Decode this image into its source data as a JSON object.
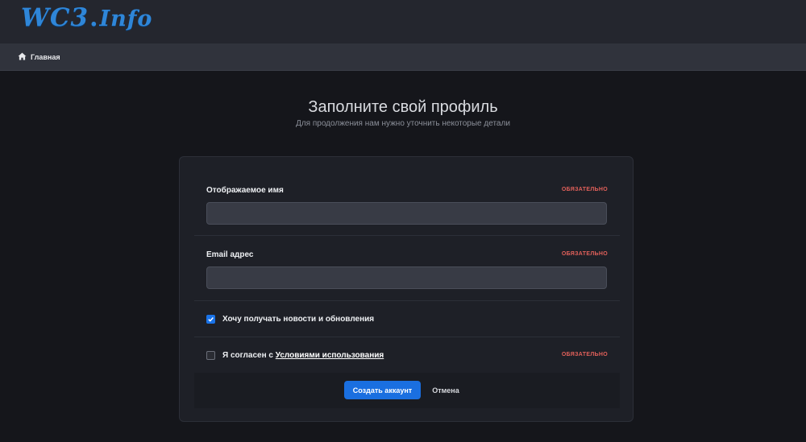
{
  "header": {
    "logo_main": "WC3",
    "logo_dot": ".",
    "logo_suffix": "Info"
  },
  "breadcrumb": {
    "home_label": "Главная",
    "home_icon": "home-icon"
  },
  "page": {
    "title": "Заполните свой профиль",
    "subtitle": "Для продолжения нам нужно уточнить некоторые детали"
  },
  "form": {
    "display_name": {
      "label": "Отображаемое имя",
      "required": "ОБЯЗАТЕЛЬНО",
      "value": ""
    },
    "email": {
      "label": "Email адрес",
      "required": "ОБЯЗАТЕЛЬНО",
      "value": ""
    },
    "newsletter": {
      "label": "Хочу получать новости и обновления",
      "checked": true
    },
    "terms": {
      "label_prefix": "Я согласен с ",
      "link_text": "Условиями использования",
      "required": "ОБЯЗАТЕЛЬНО",
      "checked": false
    },
    "submit_label": "Создать аккаунт",
    "cancel_label": "Отмена"
  },
  "colors": {
    "accent": "#1a6fe0",
    "required": "#e0605a",
    "logo": "#2f86d8",
    "background": "#15161b"
  }
}
